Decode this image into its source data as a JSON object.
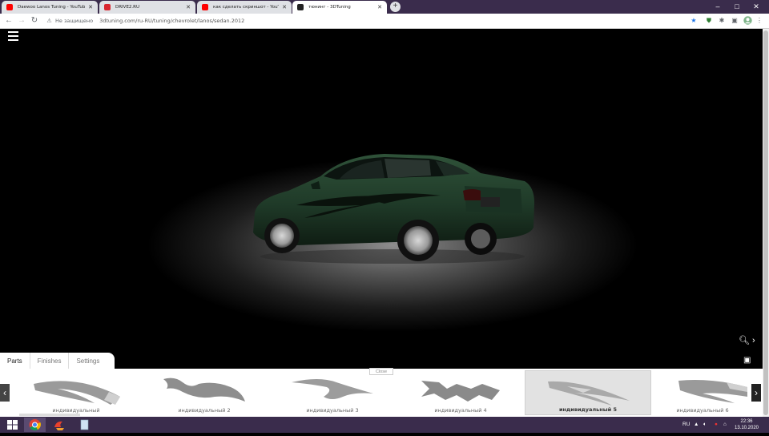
{
  "browser": {
    "tabs": [
      {
        "title": "Daewoo Lanos Tuning - YouTube",
        "icon": "youtube-icon",
        "active": false
      },
      {
        "title": "DRIVE2.RU",
        "icon": "drive2-icon",
        "active": false
      },
      {
        "title": "как сделать скриншот - YouTube",
        "icon": "youtube-icon",
        "active": false
      },
      {
        "title": "тюнинг - 3DTuning",
        "icon": "3dtuning-icon",
        "active": true
      }
    ],
    "new_tab": "+",
    "security_label": "Не защищено",
    "url": "3dtuning.com/ru-RU/tuning/chevrolet/lanos/sedan.2012"
  },
  "panel": {
    "tabs": [
      "Parts",
      "Finishes",
      "Settings"
    ],
    "close_label": "Close",
    "items": [
      {
        "label": "индивидуальный",
        "selected": false
      },
      {
        "label": "индивидуальный 2",
        "selected": false
      },
      {
        "label": "индивидуальный 3",
        "selected": false
      },
      {
        "label": "индивидуальный 4",
        "selected": false
      },
      {
        "label": "индивидуальный 5",
        "selected": true
      },
      {
        "label": "индивидуальный 6",
        "selected": false
      }
    ]
  },
  "taskbar": {
    "language": "RU",
    "time": "22:36",
    "date": "13.10.2020"
  },
  "colors": {
    "car_body": "#1f3a28",
    "taskbar": "#3a2c4c",
    "youtube": "#ff0000",
    "drive2": "#d9262e"
  }
}
